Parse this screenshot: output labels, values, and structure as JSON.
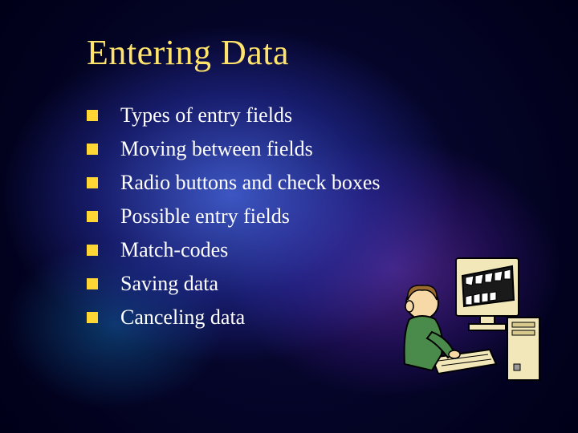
{
  "title": "Entering Data",
  "bullets": [
    {
      "label": "Types of entry fields"
    },
    {
      "label": "Moving between fields"
    },
    {
      "label": "Radio buttons and check boxes"
    },
    {
      "label": "Possible entry fields"
    },
    {
      "label": "Match-codes"
    },
    {
      "label": "Saving data"
    },
    {
      "label": "Canceling data"
    }
  ],
  "colors": {
    "title": "#ffe36a",
    "bullet_square": "#ffd633",
    "text": "#ffffff"
  },
  "image": {
    "name": "person-at-computer-clipart"
  }
}
